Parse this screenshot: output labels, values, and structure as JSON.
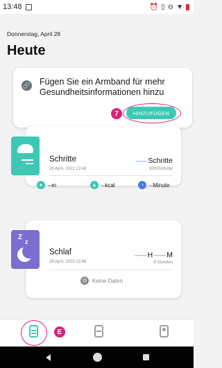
{
  "status_bar": {
    "time": "13:48"
  },
  "header": {
    "date": "Donnerstag, April 28",
    "title": "Heute"
  },
  "add_card": {
    "text": "Fügen Sie ein Armband für mehr Gesundheitsinformationen hinzu",
    "button_label": "HINZUFÜGEN",
    "callout": "7"
  },
  "steps_card": {
    "title": "Schritte",
    "timestamp": "28 April, 2022 13:48",
    "value_label": "Schritte",
    "goal": "8000Schritte",
    "metrics": [
      {
        "icon": "location-icon",
        "value": "--m",
        "color": "#3cc8b4"
      },
      {
        "icon": "flame-icon",
        "value": "--kcal",
        "color": "#3cc8b4"
      },
      {
        "icon": "clock-icon",
        "value": "--Minute",
        "color": "#4a7cf0"
      }
    ]
  },
  "sleep_card": {
    "title": "Schlaf",
    "timestamp": "28 April, 2022 13:48",
    "value_h": "H",
    "value_m": "M",
    "goal": "8 Stunden",
    "no_data": "Keine Daten"
  },
  "bottom_nav": {
    "callout": "E"
  },
  "colors": {
    "accent": "#3cc8b4",
    "callout": "#d6237a",
    "sleep": "#7a6fd0"
  }
}
